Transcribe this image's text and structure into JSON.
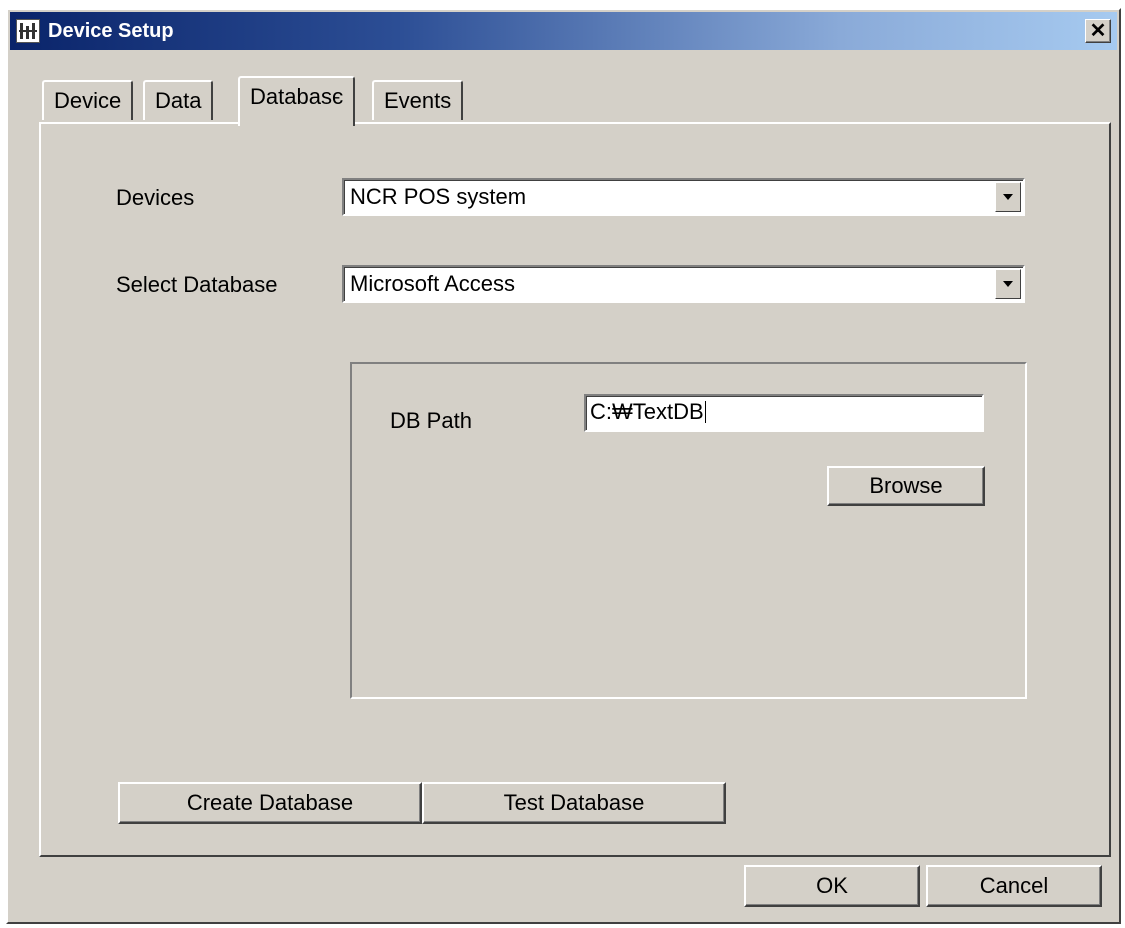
{
  "window": {
    "title": "Device Setup",
    "close_glyph": "✕",
    "icon": "app-icon"
  },
  "tabs": [
    {
      "label": "Device",
      "active": false
    },
    {
      "label": "Data",
      "active": false
    },
    {
      "label": "Databasє",
      "active": true
    },
    {
      "label": "Events",
      "active": false
    }
  ],
  "form": {
    "devices_label": "Devices",
    "devices_value": "NCR POS system",
    "select_db_label": "Select Database",
    "select_db_value": "Microsoft Access",
    "db_path_label": "DB Path",
    "db_path_value": "C:₩TextDB",
    "browse_label": "Browse",
    "create_db_label": "Create Database",
    "test_db_label": "Test Database"
  },
  "footer": {
    "ok_label": "OK",
    "cancel_label": "Cancel"
  },
  "colors": {
    "face": "#d4d0c8",
    "title_start": "#0a246a",
    "title_end": "#a6caf0"
  }
}
